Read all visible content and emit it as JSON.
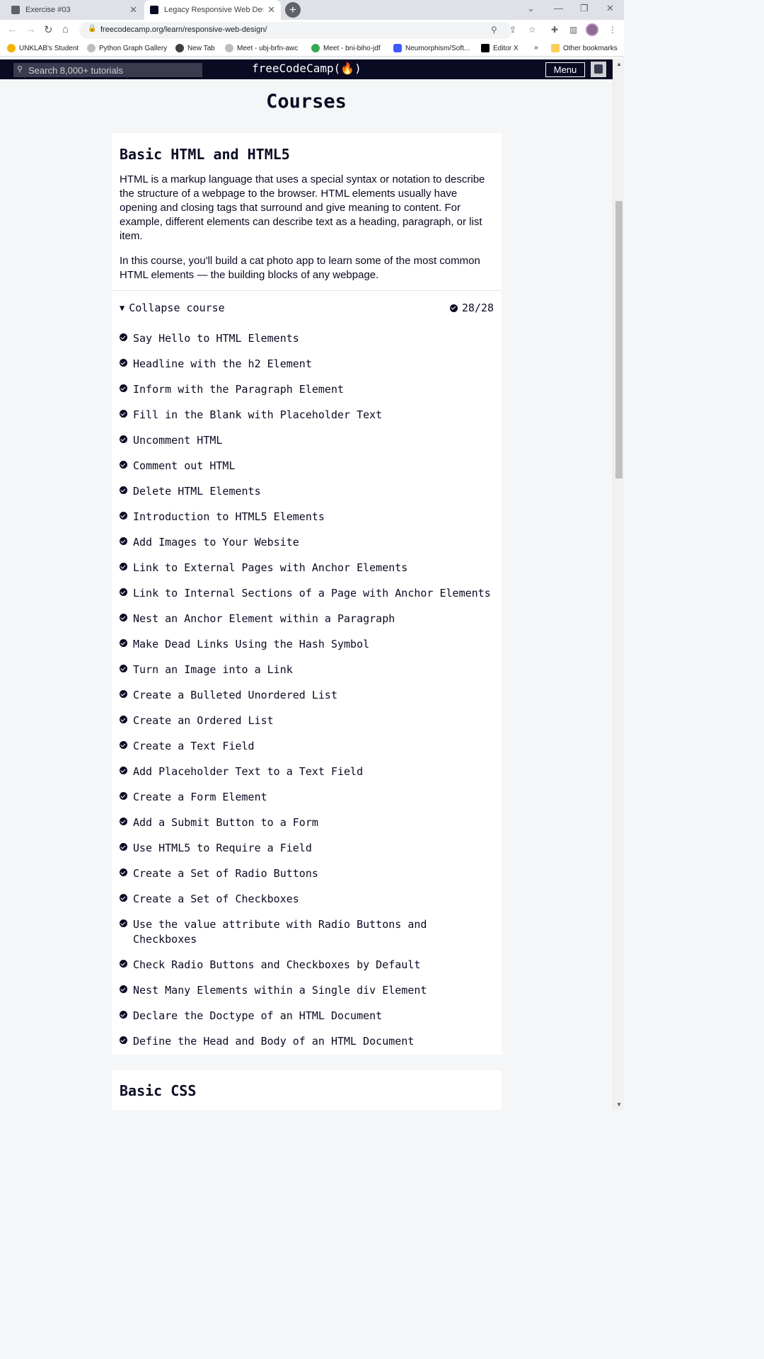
{
  "browser": {
    "tabs": [
      {
        "title": "Exercise #03",
        "active": false
      },
      {
        "title": "Legacy Responsive Web Design C",
        "active": true
      }
    ],
    "url": "freecodecamp.org/learn/responsive-web-design/",
    "bookmarks": [
      "UNKLAB's Student",
      "Python Graph Gallery",
      "New Tab",
      "Meet - ubj-brfn-awc",
      "Meet - bni-biho-jdf",
      "Neumorphism/Soft...",
      "Editor X",
      "Other bookmarks"
    ],
    "overflow": "»"
  },
  "nav": {
    "search_placeholder": "Search 8,000+ tutorials",
    "brand": "freeCodeCamp(🔥)",
    "menu_label": "Menu"
  },
  "page": {
    "heading": "Courses"
  },
  "course": {
    "title": "Basic HTML and HTML5",
    "description": [
      "HTML is a markup language that uses a special syntax or notation to describe the structure of a webpage to the browser. HTML elements usually have opening and closing tags that surround and give meaning to content. For example, different elements can describe text as a heading, paragraph, or list item.",
      "In this course, you'll build a cat photo app to learn some of the most common HTML elements — the building blocks of any webpage."
    ],
    "collapse_label": "Collapse course",
    "progress": "28/28",
    "lessons": [
      "Say Hello to HTML Elements",
      "Headline with the h2 Element",
      "Inform with the Paragraph Element",
      "Fill in the Blank with Placeholder Text",
      "Uncomment HTML",
      "Comment out HTML",
      "Delete HTML Elements",
      "Introduction to HTML5 Elements",
      "Add Images to Your Website",
      "Link to External Pages with Anchor Elements",
      "Link to Internal Sections of a Page with Anchor Elements",
      "Nest an Anchor Element within a Paragraph",
      "Make Dead Links Using the Hash Symbol",
      "Turn an Image into a Link",
      "Create a Bulleted Unordered List",
      "Create an Ordered List",
      "Create a Text Field",
      "Add Placeholder Text to a Text Field",
      "Create a Form Element",
      "Add a Submit Button to a Form",
      "Use HTML5 to Require a Field",
      "Create a Set of Radio Buttons",
      "Create a Set of Checkboxes",
      "Use the value attribute with Radio Buttons and Checkboxes",
      "Check Radio Buttons and Checkboxes by Default",
      "Nest Many Elements within a Single div Element",
      "Declare the Doctype of an HTML Document",
      "Define the Head and Body of an HTML Document"
    ]
  },
  "next_course": {
    "title": "Basic CSS"
  },
  "colors": {
    "nav_bg": "#0a0a23",
    "page_bg": "#f5f6f7",
    "card_bg": "#ffffff",
    "text": "#0a0a23"
  }
}
